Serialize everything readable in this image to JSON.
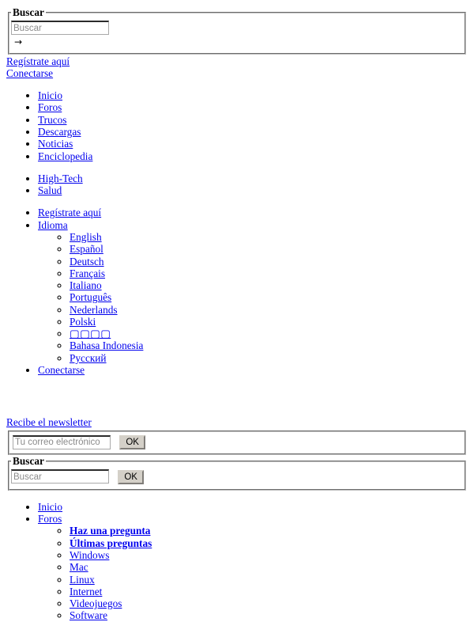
{
  "top_search": {
    "legend": "Buscar",
    "input_placeholder": "Buscar",
    "input_value": "",
    "submit_glyph": "→"
  },
  "account_links": {
    "register": "Regístrate aquí",
    "login": "Conectarse"
  },
  "main_nav": {
    "primary": [
      "Inicio",
      "Foros",
      "Trucos",
      "Descargas",
      "Noticias",
      "Enciclopedia"
    ],
    "secondary": [
      "High-Tech",
      "Salud"
    ],
    "account": [
      "Regístrate aquí",
      "Idioma",
      "Conectarse"
    ],
    "languages": [
      "English",
      "Español",
      "Deutsch",
      "Français",
      "Italiano",
      "Português",
      "Nederlands",
      "Polski",
      "▢▢▢▢",
      "Bahasa Indonesia",
      "Русский"
    ]
  },
  "newsletter": {
    "title": "Recibe el newsletter",
    "email_placeholder": "Tu correo electrónico",
    "email_value": "",
    "submit_label": "OK"
  },
  "bottom_search": {
    "legend": "Buscar",
    "input_placeholder": "Buscar",
    "input_value": "",
    "submit_label": "OK"
  },
  "footer_nav": {
    "items": [
      "Inicio",
      "Foros"
    ],
    "forum_sub": [
      {
        "label": "Haz una pregunta",
        "bold": true
      },
      {
        "label": "Últimas preguntas",
        "bold": true
      },
      {
        "label": "Windows",
        "bold": false
      },
      {
        "label": "Mac",
        "bold": false
      },
      {
        "label": "Linux",
        "bold": false
      },
      {
        "label": "Internet",
        "bold": false
      },
      {
        "label": "Videojuegos",
        "bold": false
      },
      {
        "label": "Software",
        "bold": false
      }
    ]
  },
  "colors": {
    "link": "#0000ee",
    "text": "#000000",
    "background": "#ffffff",
    "field_border": "#a9a9a9",
    "button_face": "#d4d0c8"
  }
}
